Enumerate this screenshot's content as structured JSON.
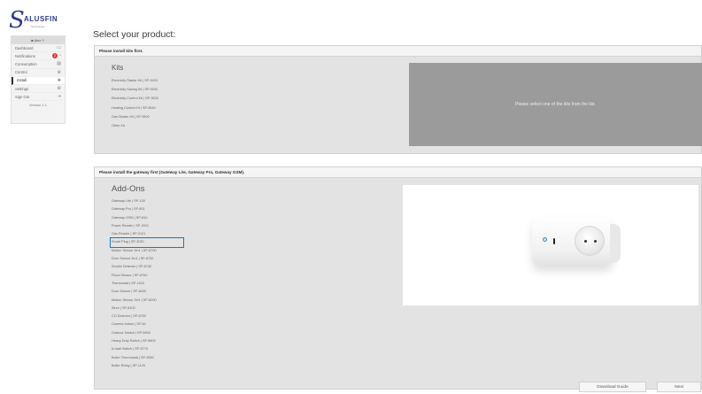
{
  "logo": {
    "text": "ALUSFIN",
    "initial": "S",
    "tagline": "Technology"
  },
  "sidebar": {
    "header": "■ Alex Y.",
    "items": [
      {
        "label": "Dashboard",
        "icon": "dashboard-icon",
        "glyph": "▭"
      },
      {
        "label": "Notifications",
        "icon": "bell-icon",
        "glyph": "◔",
        "badge": "2"
      },
      {
        "label": "Consumption",
        "icon": "chart-icon",
        "glyph": "▤"
      },
      {
        "label": "Control",
        "icon": "settings-icon",
        "glyph": "⚙"
      },
      {
        "label": "Install",
        "icon": "plus-icon",
        "glyph": "✚",
        "active": true
      },
      {
        "label": "Settings",
        "icon": "gear-icon",
        "glyph": "⚙"
      },
      {
        "label": "Sign Out",
        "icon": "logout-icon",
        "glyph": "⇥"
      }
    ],
    "version": "Version 1.1"
  },
  "main": {
    "title": "Select your product:",
    "kits": {
      "header": "Please install kits first.",
      "list_title": "Kits",
      "items": [
        "Electricity Starter Kit | SP-9020",
        "Electricity Saving Kit | SP-9030",
        "Electricity Control Kit | SP-9520",
        "Heating Control Kit | SP-9540",
        "Gas Starter Kit | SP-9500",
        "Other Kit"
      ],
      "placeholder": "Please select one of the kits from the list."
    },
    "addons": {
      "header": "Please install the gateway first (Gateway Lite, Gateway Pro, Gateway GSM).",
      "list_title": "Add-Ons",
      "selected_index": 6,
      "items": [
        "Gateway Lite | SP-100",
        "Gateway Pro | SP-801",
        "Gateway GSM | SP-810",
        "Power Reader | SP-2021",
        "Gas Reader | SP-2121",
        "Smart Plug | SP-3030",
        "Motion Sensor 4in1 | SP-8700",
        "Door Sensor 4in1 | SP-8720",
        "Smoke Detector | SP-8740",
        "Flood Sensor | SP-8760",
        "Thermostat | SP-1010",
        "Door Sensor | SP-8420",
        "Motion Sensor 2in1 | SP-8200",
        "Siren | SP-8100",
        "CO Detector | SP-8750",
        "Camera Indoor | SP-81",
        "Outdoor Switch | SP-5500",
        "Heavy Duty Switch | SP-5800",
        "In-wall Switch | SP-5770",
        "Boiler Thermostat | SP-9050",
        "Boiler Relay | SP-1120"
      ],
      "image_alt": "Smart Plug product photo"
    }
  },
  "footer": {
    "download_label": "Download Guide",
    "next_label": "Next"
  },
  "colors": {
    "selection_outline": "#1e74c8",
    "placeholder_bg": "#9b9b9b",
    "badge": "#e53935",
    "brand": "#2b3a8c"
  }
}
